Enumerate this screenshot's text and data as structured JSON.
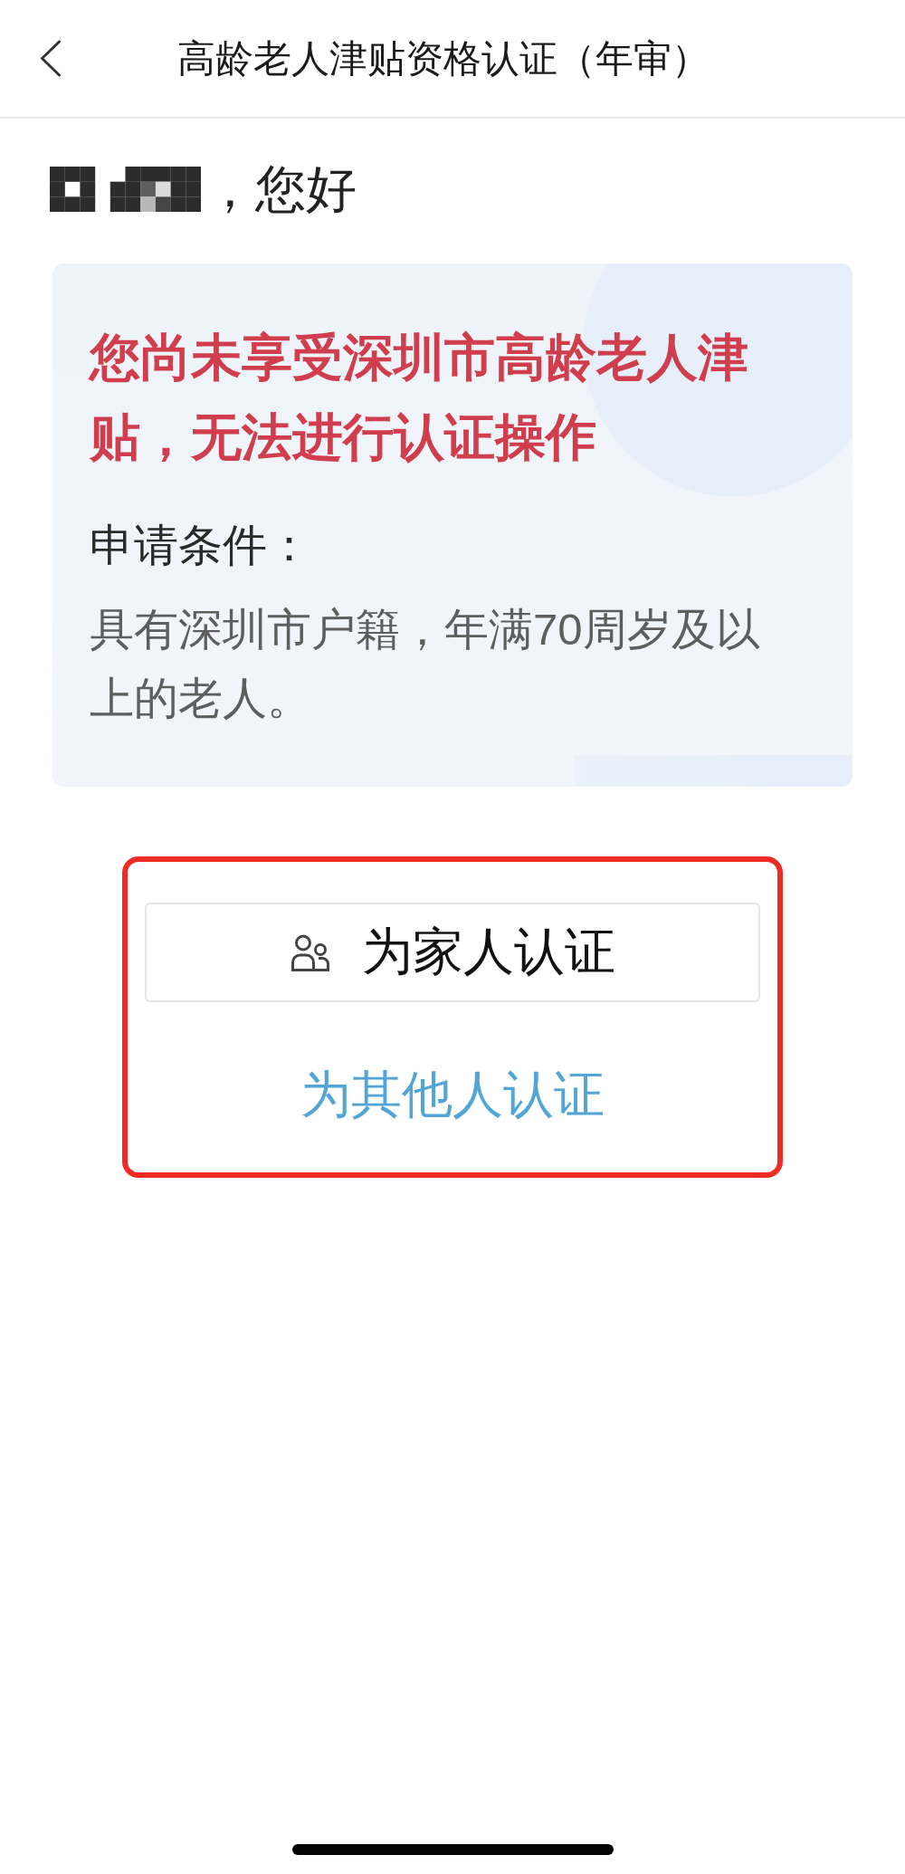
{
  "header": {
    "title": "高龄老人津贴资格认证（年审）"
  },
  "greeting": {
    "text": "，您好"
  },
  "card": {
    "notice": "您尚未享受深圳市高龄老人津贴，无法进行认证操作",
    "conditions_label": "申请条件：",
    "conditions_text": "具有深圳市户籍，年满70周岁及以上的老人。"
  },
  "actions": {
    "highlighted": true,
    "items": [
      {
        "kind": "outlined",
        "label": "为家人认证"
      },
      {
        "kind": "link",
        "label": "为其他人认证"
      }
    ]
  }
}
